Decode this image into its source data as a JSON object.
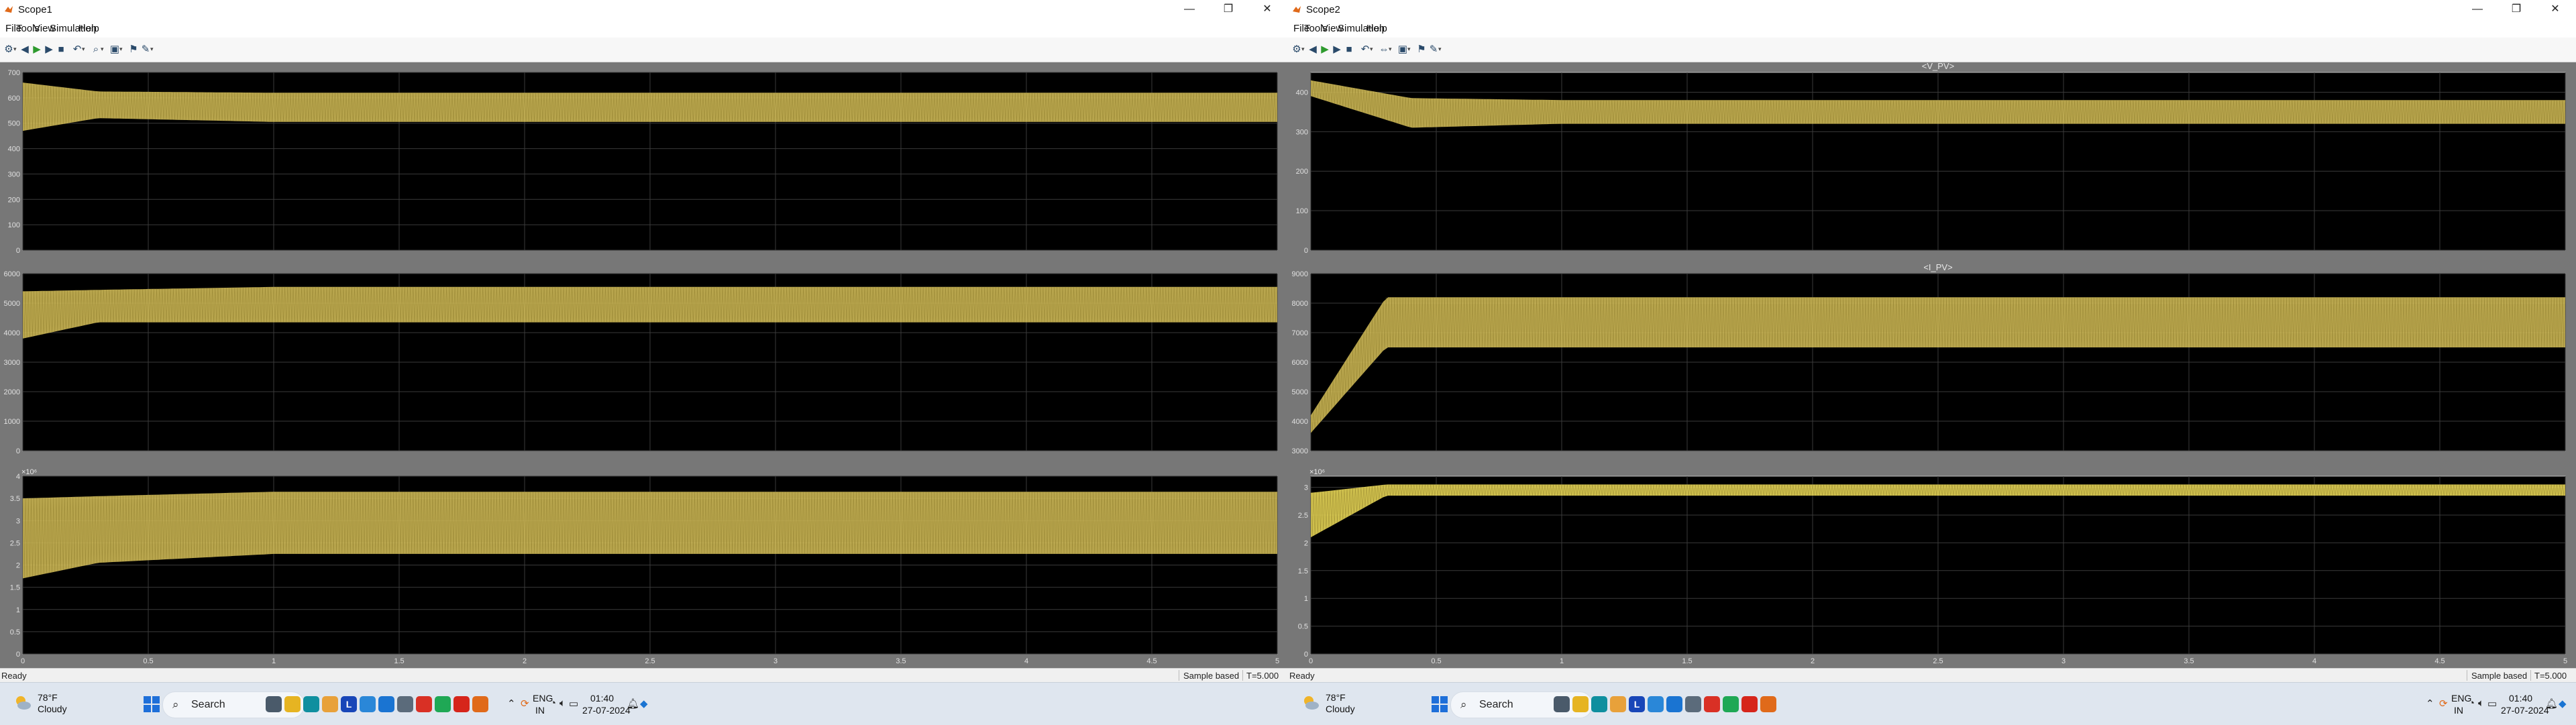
{
  "windows": [
    {
      "title": "Scope1",
      "menu": [
        "File",
        "Tools",
        "View",
        "Simulation",
        "Help"
      ],
      "status": {
        "left": "Ready",
        "mid": "Sample based",
        "right": "T=5.000"
      },
      "axes": [
        {
          "title": "",
          "multiplier": "",
          "ylim": [
            0,
            700
          ],
          "yticks": [
            "0",
            "100",
            "200",
            "300",
            "400",
            "500",
            "600",
            "700"
          ]
        },
        {
          "title": "",
          "multiplier": "",
          "ylim": [
            0,
            6000
          ],
          "yticks": [
            "0",
            "1000",
            "2000",
            "3000",
            "4000",
            "5000",
            "6000"
          ]
        },
        {
          "title": "",
          "multiplier": "×10⁶",
          "ylim": [
            0,
            4
          ],
          "yticks": [
            "0",
            "0.5",
            "1",
            "1.5",
            "2",
            "2.5",
            "3",
            "3.5",
            "4"
          ]
        }
      ],
      "xticks": [
        "0",
        "0.5",
        "1",
        "1.5",
        "2",
        "2.5",
        "3",
        "3.5",
        "4",
        "4.5",
        "5"
      ]
    },
    {
      "title": "Scope2",
      "menu": [
        "File",
        "Tools",
        "View",
        "Simulation",
        "Help"
      ],
      "status": {
        "left": "Ready",
        "mid": "Sample based",
        "right": "T=5.000"
      },
      "axes": [
        {
          "title": "<V_PV>",
          "multiplier": "",
          "ylim": [
            0,
            450
          ],
          "yticks": [
            "0",
            "100",
            "200",
            "300",
            "400"
          ]
        },
        {
          "title": "<I_PV>",
          "multiplier": "",
          "ylim": [
            3000,
            9000
          ],
          "yticks": [
            "3000",
            "4000",
            "5000",
            "6000",
            "7000",
            "8000",
            "9000"
          ]
        },
        {
          "title": "",
          "multiplier": "×10⁶",
          "ylim": [
            0,
            3.2
          ],
          "yticks": [
            "0",
            "0.5",
            "1",
            "1.5",
            "2",
            "2.5",
            "3"
          ]
        }
      ],
      "xticks": [
        "0",
        "0.5",
        "1",
        "1.5",
        "2",
        "2.5",
        "3",
        "3.5",
        "4",
        "4.5",
        "5"
      ]
    }
  ],
  "chart_data": [
    {
      "type": "area",
      "title": "",
      "x": [
        0,
        0.3,
        1,
        5
      ],
      "xlim": [
        0,
        5
      ],
      "ylim": [
        0,
        700
      ],
      "upper": [
        660,
        625,
        620,
        620
      ],
      "lower": [
        470,
        520,
        505,
        505
      ],
      "color": "#d8c25a",
      "grid": true
    },
    {
      "type": "area",
      "title": "",
      "x": [
        0,
        0.3,
        1,
        5
      ],
      "xlim": [
        0,
        5
      ],
      "ylim": [
        0,
        6000
      ],
      "upper": [
        5400,
        5450,
        5550,
        5550
      ],
      "lower": [
        3800,
        4350,
        4350,
        4350
      ],
      "color": "#d8c25a",
      "grid": true
    },
    {
      "type": "area",
      "title": "",
      "x": [
        0,
        0.3,
        1,
        5
      ],
      "xlim": [
        0,
        5
      ],
      "ylim": [
        0,
        4
      ],
      "upper": [
        3.5,
        3.55,
        3.65,
        3.65
      ],
      "lower": [
        1.7,
        2.05,
        2.25,
        2.25
      ],
      "color": "#d8c25a",
      "grid": true
    },
    {
      "type": "area",
      "title": "<V_PV>",
      "x": [
        0,
        0.4,
        1,
        5
      ],
      "xlim": [
        0,
        5
      ],
      "ylim": [
        0,
        450
      ],
      "upper": [
        430,
        385,
        380,
        380
      ],
      "lower": [
        390,
        310,
        320,
        320
      ],
      "color": "#d8c25a",
      "grid": true
    },
    {
      "type": "area",
      "title": "<I_PV>",
      "x": [
        0,
        0.3,
        1,
        5
      ],
      "xlim": [
        0,
        5
      ],
      "ylim": [
        3000,
        9000
      ],
      "upper": [
        4200,
        8200,
        8200,
        8200
      ],
      "lower": [
        3600,
        6500,
        6500,
        6500
      ],
      "color": "#d8c25a",
      "grid": true
    },
    {
      "type": "area",
      "title": "",
      "x": [
        0,
        0.3,
        1,
        5
      ],
      "xlim": [
        0,
        5
      ],
      "ylim": [
        0,
        3.2
      ],
      "upper": [
        2.9,
        3.05,
        3.05,
        3.05
      ],
      "lower": [
        2.1,
        2.85,
        2.85,
        2.85
      ],
      "color": "#f2e15a",
      "grid": true
    }
  ],
  "taskbar": {
    "instances": [
      {
        "weather_temp": "78°F",
        "weather_cond": "Cloudy",
        "search": "Search",
        "lang1": "ENG",
        "lang2": "IN",
        "time": "01:40",
        "date": "27-07-2024",
        "apps": [
          {
            "icon": "windows-start-icon",
            "label": "",
            "color": "#1e6fd9"
          },
          {
            "icon": "taskview-icon",
            "label": "",
            "color": "#4a5a6a"
          },
          {
            "icon": "file-explorer-icon",
            "label": "",
            "color": "#e6b422"
          },
          {
            "icon": "edge-icon",
            "label": "",
            "color": "#0f8f9f"
          },
          {
            "icon": "store-icon",
            "label": "",
            "color": "#e8a13a"
          },
          {
            "icon": "l-app-icon",
            "label": "L",
            "color": "#1846b8"
          },
          {
            "icon": "pen-app-icon",
            "label": "",
            "color": "#2a87d8"
          },
          {
            "icon": "calendar-app-icon",
            "label": "",
            "color": "#1a74d2"
          },
          {
            "icon": "settings-icon",
            "label": "",
            "color": "#5b6b7b"
          },
          {
            "icon": "chrome-icon",
            "label": "",
            "color": "#d93025"
          },
          {
            "icon": "whatsapp-icon",
            "label": "",
            "color": "#1fa855"
          },
          {
            "icon": "acrobat-icon",
            "label": "",
            "color": "#d6251b"
          },
          {
            "icon": "matlab-icon",
            "label": "",
            "color": "#e06a1a"
          }
        ]
      },
      {
        "weather_temp": "78°F",
        "weather_cond": "Cloudy",
        "search": "Search",
        "lang1": "ENG",
        "lang2": "IN",
        "time": "01:40",
        "date": "27-07-2024",
        "apps": [
          {
            "icon": "windows-start-icon",
            "label": "",
            "color": "#1e6fd9"
          },
          {
            "icon": "taskview-icon",
            "label": "",
            "color": "#4a5a6a"
          },
          {
            "icon": "file-explorer-icon",
            "label": "",
            "color": "#e6b422"
          },
          {
            "icon": "edge-icon",
            "label": "",
            "color": "#0f8f9f"
          },
          {
            "icon": "store-icon",
            "label": "",
            "color": "#e8a13a"
          },
          {
            "icon": "l-app-icon",
            "label": "L",
            "color": "#1846b8"
          },
          {
            "icon": "pen-app-icon",
            "label": "",
            "color": "#2a87d8"
          },
          {
            "icon": "calendar-app-icon",
            "label": "",
            "color": "#1a74d2"
          },
          {
            "icon": "settings-icon",
            "label": "",
            "color": "#5b6b7b"
          },
          {
            "icon": "chrome-icon",
            "label": "",
            "color": "#d93025"
          },
          {
            "icon": "whatsapp-icon",
            "label": "",
            "color": "#1fa855"
          },
          {
            "icon": "acrobat-icon",
            "label": "",
            "color": "#d6251b"
          },
          {
            "icon": "matlab-icon",
            "label": "",
            "color": "#e06a1a"
          }
        ]
      }
    ]
  }
}
